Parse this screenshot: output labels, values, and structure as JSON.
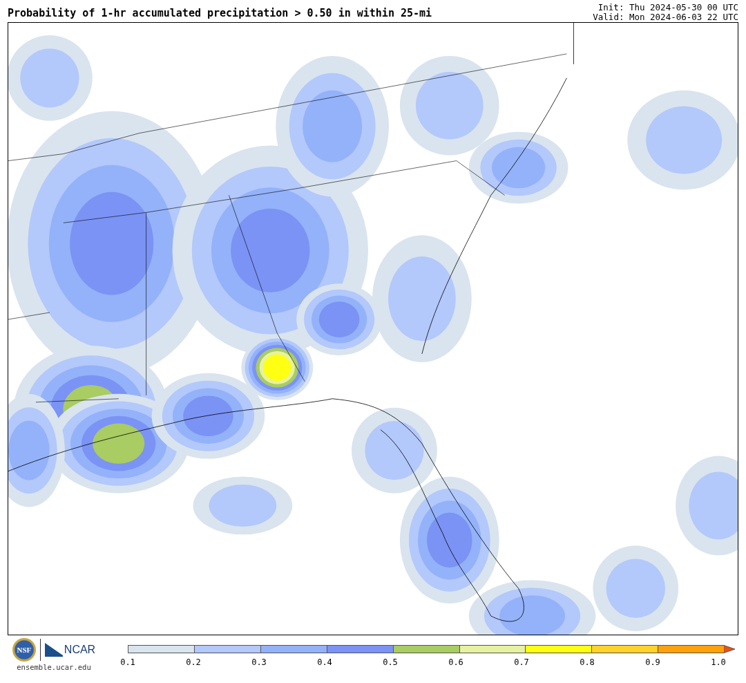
{
  "title": "Probability of 1-hr accumulated precipitation > 0.50 in within 25-mi",
  "init": "Init: Thu 2024-05-30 00 UTC",
  "valid": "Valid: Mon 2024-06-03 22 UTC",
  "logos": {
    "nsf": "NSF",
    "ncar": "NCAR",
    "website": "ensemble.ucar.edu"
  },
  "colorbar": {
    "bins": [
      {
        "color": "#d9e4ef"
      },
      {
        "color": "#b3c8fb"
      },
      {
        "color": "#93b2f9"
      },
      {
        "color": "#7b93f5"
      },
      {
        "color": "#a9cc63"
      },
      {
        "color": "#e6f2a2"
      },
      {
        "color": "#ffff14"
      },
      {
        "color": "#ffd32c"
      },
      {
        "color": "#ffa10c"
      }
    ],
    "extension": {
      "color": "#f0500f"
    },
    "labels": [
      "0.1",
      "0.2",
      "0.3",
      "0.4",
      "0.5",
      "0.6",
      "0.7",
      "0.8",
      "0.9",
      "1.0"
    ]
  }
}
